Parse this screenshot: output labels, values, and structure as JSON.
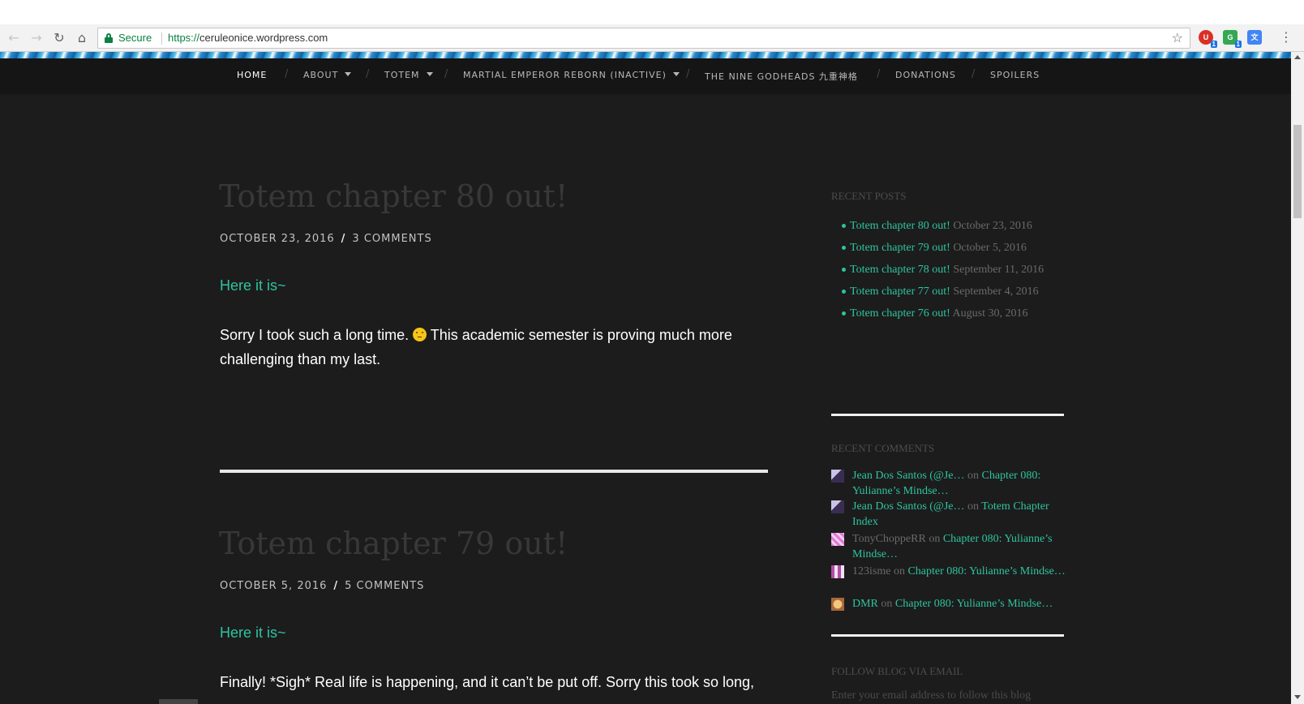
{
  "browser": {
    "back_icon": "arrow-left-icon",
    "forward_icon": "arrow-right-icon",
    "reload_icon": "reload-icon",
    "home_icon": "home-icon",
    "secure_label": "Secure",
    "url_scheme": "https://",
    "url_rest": "ceruleonice.wordpress.com",
    "extensions": [
      {
        "name": "ublock-extension-icon",
        "badge": "1"
      },
      {
        "name": "grammarly-extension-icon",
        "badge": "1"
      },
      {
        "name": "translate-extension-icon",
        "badge": ""
      }
    ]
  },
  "nav": {
    "items": [
      {
        "label": "HOME",
        "active": true,
        "dropdown": false
      },
      {
        "label": "ABOUT",
        "active": false,
        "dropdown": true
      },
      {
        "label": "TOTEM",
        "active": false,
        "dropdown": true
      },
      {
        "label": "MARTIAL EMPEROR REBORN (INACTIVE)",
        "active": false,
        "dropdown": true
      },
      {
        "label": "THE NINE GODHEADS 九重神格",
        "active": false,
        "dropdown": false
      },
      {
        "label": "DONATIONS",
        "active": false,
        "dropdown": false
      },
      {
        "label": "SPOILERS",
        "active": false,
        "dropdown": false
      }
    ],
    "separator": "/"
  },
  "posts": [
    {
      "title": "Totem chapter 80 out!",
      "date": "OCTOBER 23, 2016",
      "comments": "3 COMMENTS",
      "link": "Here it is~",
      "text_before": "Sorry I took such a long time. ",
      "text_after": " This academic semester is proving much more challenging than my last."
    },
    {
      "title": "Totem chapter 79 out!",
      "date": "OCTOBER 5, 2016",
      "comments": "5 COMMENTS",
      "link": "Here it is~",
      "text": "Finally! *Sigh* Real life is happening, and it can’t be put off. Sorry this took so long,"
    }
  ],
  "sidebar": {
    "recent_posts_title": "RECENT POSTS",
    "recent_posts": [
      {
        "title": "Totem chapter 80 out!",
        "date": "October 23, 2016"
      },
      {
        "title": "Totem chapter 79 out!",
        "date": "October 5, 2016"
      },
      {
        "title": "Totem chapter 78 out!",
        "date": "September 11, 2016"
      },
      {
        "title": "Totem chapter 77 out!",
        "date": "September 4, 2016"
      },
      {
        "title": "Totem chapter 76 out!",
        "date": "August 30, 2016"
      }
    ],
    "recent_comments_title": "RECENT COMMENTS",
    "recent_comments": [
      {
        "author": "Jean Dos Santos (@Je…",
        "on": "on",
        "post": "Chapter 080: Yulianne’s Mindse…"
      },
      {
        "author": "Jean Dos Santos (@Je…",
        "on": "on",
        "post": "Totem Chapter Index"
      },
      {
        "author": "TonyChoppeRR",
        "on": "on",
        "post": "Chapter 080: Yulianne’s Mindse…"
      },
      {
        "author": "123isme",
        "on": "on",
        "post": "Chapter 080: Yulianne’s Mindse…"
      },
      {
        "author": "DMR",
        "on": "on",
        "post": "Chapter 080: Yulianne’s Mindse…"
      }
    ],
    "follow_title": "FOLLOW BLOG VIA EMAIL",
    "follow_placeholder": "Enter your email address to follow this blog"
  },
  "colors": {
    "accent": "#2ec4a0",
    "background": "#1c1c1c",
    "nav_background": "#151515"
  }
}
